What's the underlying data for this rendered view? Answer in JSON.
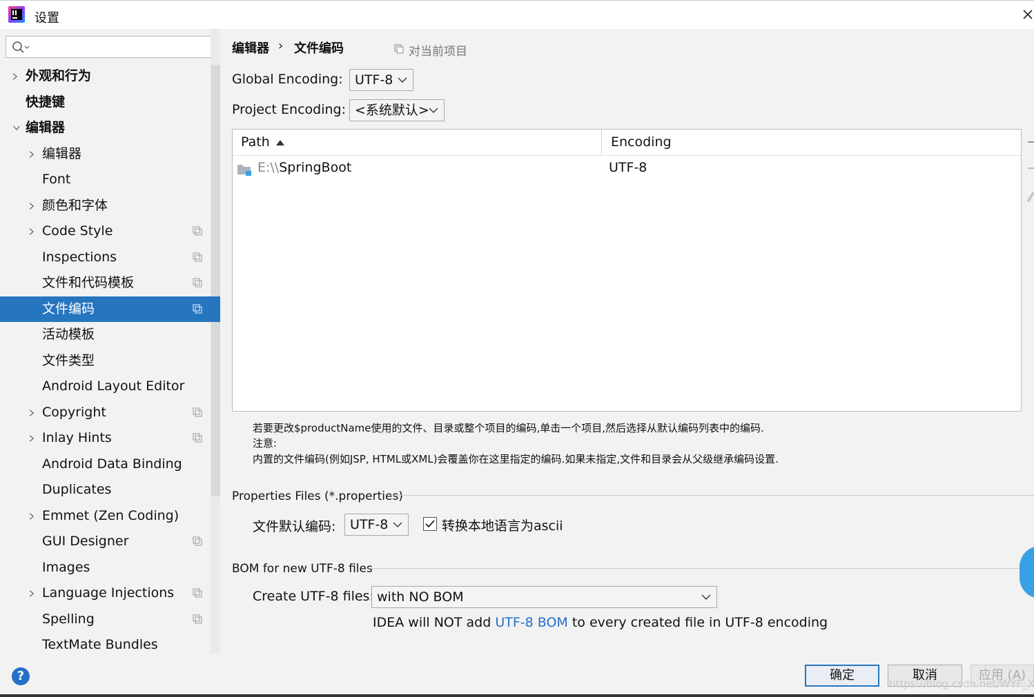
{
  "window": {
    "title": "设置"
  },
  "search": {
    "placeholder": ""
  },
  "sidebar": {
    "items": [
      {
        "label": "外观和行为",
        "level": 0,
        "expandable": true,
        "expanded": false,
        "bold": true,
        "copy_icon": false,
        "selected": false
      },
      {
        "label": "快捷键",
        "level": 0,
        "expandable": false,
        "expanded": false,
        "bold": true,
        "copy_icon": false,
        "selected": false
      },
      {
        "label": "编辑器",
        "level": 0,
        "expandable": true,
        "expanded": true,
        "bold": true,
        "copy_icon": false,
        "selected": false
      },
      {
        "label": "编辑器",
        "level": 1,
        "expandable": true,
        "expanded": false,
        "bold": false,
        "copy_icon": false,
        "selected": false
      },
      {
        "label": "Font",
        "level": 1,
        "expandable": false,
        "expanded": false,
        "bold": false,
        "copy_icon": false,
        "selected": false
      },
      {
        "label": "颜色和字体",
        "level": 1,
        "expandable": true,
        "expanded": false,
        "bold": false,
        "copy_icon": false,
        "selected": false
      },
      {
        "label": "Code Style",
        "level": 1,
        "expandable": true,
        "expanded": false,
        "bold": false,
        "copy_icon": true,
        "selected": false
      },
      {
        "label": "Inspections",
        "level": 1,
        "expandable": false,
        "expanded": false,
        "bold": false,
        "copy_icon": true,
        "selected": false
      },
      {
        "label": "文件和代码模板",
        "level": 1,
        "expandable": false,
        "expanded": false,
        "bold": false,
        "copy_icon": true,
        "selected": false
      },
      {
        "label": "文件编码",
        "level": 1,
        "expandable": false,
        "expanded": false,
        "bold": false,
        "copy_icon": true,
        "selected": true
      },
      {
        "label": "活动模板",
        "level": 1,
        "expandable": false,
        "expanded": false,
        "bold": false,
        "copy_icon": false,
        "selected": false
      },
      {
        "label": "文件类型",
        "level": 1,
        "expandable": false,
        "expanded": false,
        "bold": false,
        "copy_icon": false,
        "selected": false
      },
      {
        "label": "Android Layout Editor",
        "level": 1,
        "expandable": false,
        "expanded": false,
        "bold": false,
        "copy_icon": false,
        "selected": false
      },
      {
        "label": "Copyright",
        "level": 1,
        "expandable": true,
        "expanded": false,
        "bold": false,
        "copy_icon": true,
        "selected": false
      },
      {
        "label": "Inlay Hints",
        "level": 1,
        "expandable": true,
        "expanded": false,
        "bold": false,
        "copy_icon": true,
        "selected": false
      },
      {
        "label": "Android Data Binding",
        "level": 1,
        "expandable": false,
        "expanded": false,
        "bold": false,
        "copy_icon": false,
        "selected": false
      },
      {
        "label": "Duplicates",
        "level": 1,
        "expandable": false,
        "expanded": false,
        "bold": false,
        "copy_icon": false,
        "selected": false
      },
      {
        "label": "Emmet (Zen Coding)",
        "level": 1,
        "expandable": true,
        "expanded": false,
        "bold": false,
        "copy_icon": false,
        "selected": false
      },
      {
        "label": "GUI Designer",
        "level": 1,
        "expandable": false,
        "expanded": false,
        "bold": false,
        "copy_icon": true,
        "selected": false
      },
      {
        "label": "Images",
        "level": 1,
        "expandable": false,
        "expanded": false,
        "bold": false,
        "copy_icon": false,
        "selected": false
      },
      {
        "label": "Language Injections",
        "level": 1,
        "expandable": true,
        "expanded": false,
        "bold": false,
        "copy_icon": true,
        "selected": false
      },
      {
        "label": "Spelling",
        "level": 1,
        "expandable": false,
        "expanded": false,
        "bold": false,
        "copy_icon": true,
        "selected": false
      },
      {
        "label": "TextMate Bundles",
        "level": 1,
        "expandable": false,
        "expanded": false,
        "bold": false,
        "copy_icon": false,
        "selected": false
      }
    ]
  },
  "breadcrumb": {
    "parent": "编辑器",
    "separator": "›",
    "current": "文件编码",
    "scope": "对当前项目"
  },
  "encoding": {
    "global_label": "Global Encoding:",
    "global_value": "UTF-8",
    "project_label": "Project Encoding:",
    "project_value": "<系统默认>"
  },
  "table": {
    "columns": [
      "Path",
      "Encoding"
    ],
    "rows": [
      {
        "path_prefix": "E:\\\\",
        "path_name": "SpringBoot",
        "encoding": "UTF-8"
      }
    ]
  },
  "notes": {
    "line1": "若要更改$productName使用的文件、目录或整个项目的编码,单击一个项目,然后选择从默认编码列表中的编码.",
    "line2": "注意:",
    "line3": "内置的文件编码(例如JSP, HTML或XML)会覆盖你在这里指定的编码.如果未指定,文件和目录会从父级继承编码设置."
  },
  "properties": {
    "title": "Properties Files (*.properties)",
    "default_label": "文件默认编码:",
    "default_value": "UTF-8",
    "ascii_label": "转换本地语言为ascii",
    "ascii_checked": true
  },
  "bom": {
    "title": "BOM for new UTF-8 files",
    "create_label": "Create UTF-8 files:",
    "create_value": "with NO BOM",
    "desc_prefix": "IDEA will NOT add ",
    "desc_link": "UTF-8 BOM",
    "desc_suffix": " to every created file in UTF-8 encoding"
  },
  "footer": {
    "help": "?",
    "ok": "确定",
    "cancel": "取消",
    "apply": "应用 (A)",
    "watermark": "https://blog.csdn.net/WYF_XY"
  },
  "colors": {
    "selection": "#2675bf",
    "link": "#2470c8",
    "panel": "#f2f2f2"
  }
}
